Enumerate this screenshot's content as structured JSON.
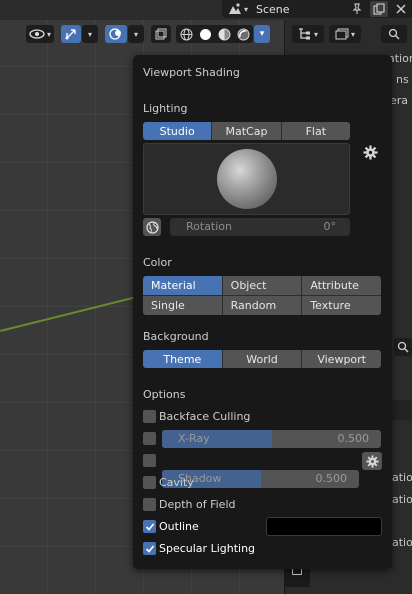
{
  "scene": {
    "name": "Scene"
  },
  "panel": {
    "title": "Viewport Shading",
    "lighting": {
      "heading": "Lighting",
      "modes": [
        "Studio",
        "MatCap",
        "Flat"
      ],
      "active": "Studio",
      "rotation_label": "Rotation",
      "rotation_value": "0°"
    },
    "color": {
      "heading": "Color",
      "options": [
        "Material",
        "Object",
        "Attribute",
        "Single",
        "Random",
        "Texture"
      ],
      "active": "Material"
    },
    "background": {
      "heading": "Background",
      "options": [
        "Theme",
        "World",
        "Viewport"
      ],
      "active": "Theme"
    },
    "options": {
      "heading": "Options",
      "backface_culling": "Backface Culling",
      "xray_label": "X-Ray",
      "xray_value": "0.500",
      "xray_level": 0.5,
      "shadow_label": "Shadow",
      "shadow_value": "0.500",
      "shadow_level": 0.5,
      "cavity": "Cavity",
      "depth_of_field": "Depth of Field",
      "outline": "Outline",
      "outline_checked": true,
      "outline_color": "#000000",
      "specular_lighting": "Specular Lighting",
      "specular_checked": true
    }
  },
  "right_panel": {
    "fragments": [
      "ation",
      "ns",
      "era",
      "ation",
      "ation",
      "ation"
    ]
  },
  "colors": {
    "accent": "#4772b3",
    "x_axis": "#6c8a2b"
  }
}
